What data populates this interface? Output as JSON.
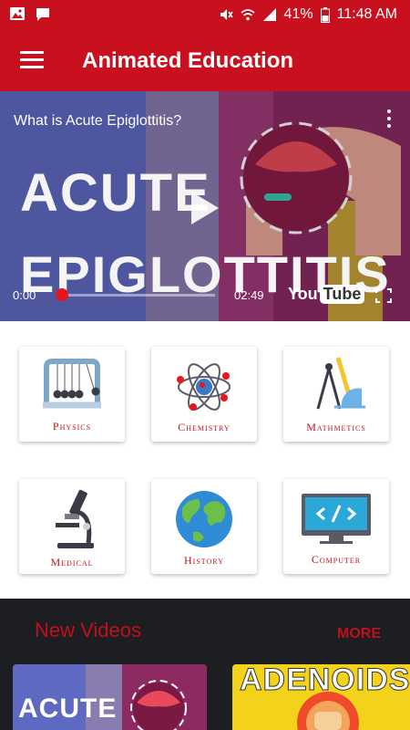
{
  "status_bar": {
    "battery": "41%",
    "time": "11:48 AM",
    "icons": [
      "image-icon",
      "chat-icon",
      "mute-icon",
      "wifi-icon",
      "signal-icon",
      "battery-icon"
    ]
  },
  "app_bar": {
    "title": "Animated Education",
    "menu_icon": "hamburger-menu-icon"
  },
  "video_player": {
    "title": "What is Acute Epiglottitis?",
    "overlay_line1": "ACUTE",
    "overlay_line2": "EPIGLOTTITIS",
    "current_time": "0:00",
    "duration": "02:49",
    "progress": 0,
    "brand_you": "You",
    "brand_tube": "Tube"
  },
  "categories": [
    {
      "label": "Physics",
      "icon": "newtons-cradle-icon"
    },
    {
      "label": "Chemistry",
      "icon": "atom-icon"
    },
    {
      "label": "Mathmetics",
      "icon": "compass-ruler-icon"
    },
    {
      "label": "Medical",
      "icon": "microscope-icon"
    },
    {
      "label": "History",
      "icon": "globe-icon"
    },
    {
      "label": "Computer",
      "icon": "code-monitor-icon"
    }
  ],
  "new_videos": {
    "heading": "New Videos",
    "more_label": "MORE",
    "items": [
      {
        "thumb_text": "ACUTE"
      },
      {
        "thumb_text": "ADENOIDS"
      }
    ]
  },
  "colors": {
    "primary": "#c8101e",
    "accent_text": "#c0101c",
    "dark_section": "#1c1e22"
  }
}
